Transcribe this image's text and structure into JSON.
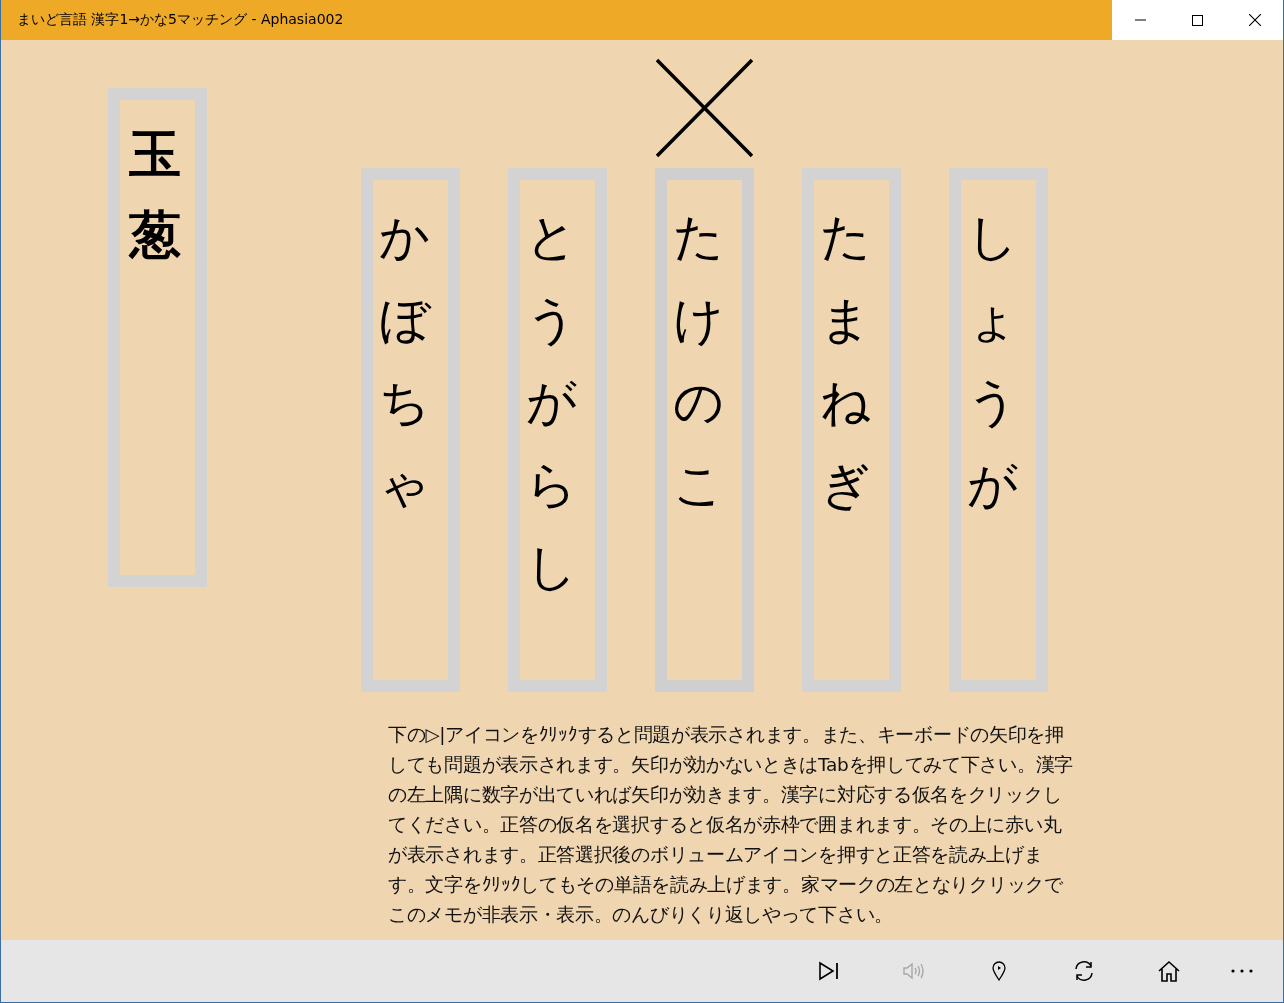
{
  "window": {
    "title": "まいど言語 漢字1→かな5マッチング - Aphasia002"
  },
  "kanji_card": {
    "text": "玉葱"
  },
  "kana_cards": [
    {
      "text": "かぼちゃ",
      "marked_wrong": false
    },
    {
      "text": "とうがらし",
      "marked_wrong": false
    },
    {
      "text": "たけのこ",
      "marked_wrong": true
    },
    {
      "text": "たまねぎ",
      "marked_wrong": false
    },
    {
      "text": "しょうが",
      "marked_wrong": false
    }
  ],
  "memo": "下の▷|アイコンをｸﾘｯｸすると問題が表示されます。また、キーボードの矢印を押しても問題が表示されます。矢印が効かないときはTabを押してみて下さい。漢字の左上隅に数字が出ていれば矢印が効きます。漢字に対応する仮名をクリックしてください。正答の仮名を選択すると仮名が赤枠で囲まれます。その上に赤い丸が表示されます。正答選択後のボリュームアイコンを押すと正答を読み上げます。文字をｸﾘｯｸしてもその単語を読み上げます。家マークの左となりクリックでこのメモが非表示・表示。のんびりくり返しやって下さい。",
  "toolbar": [
    {
      "kind": "next",
      "disabled": false
    },
    {
      "kind": "volume",
      "disabled": true
    },
    {
      "kind": "pin",
      "disabled": false
    },
    {
      "kind": "refresh",
      "disabled": false
    },
    {
      "kind": "home",
      "disabled": false
    },
    {
      "kind": "more",
      "disabled": false
    }
  ]
}
